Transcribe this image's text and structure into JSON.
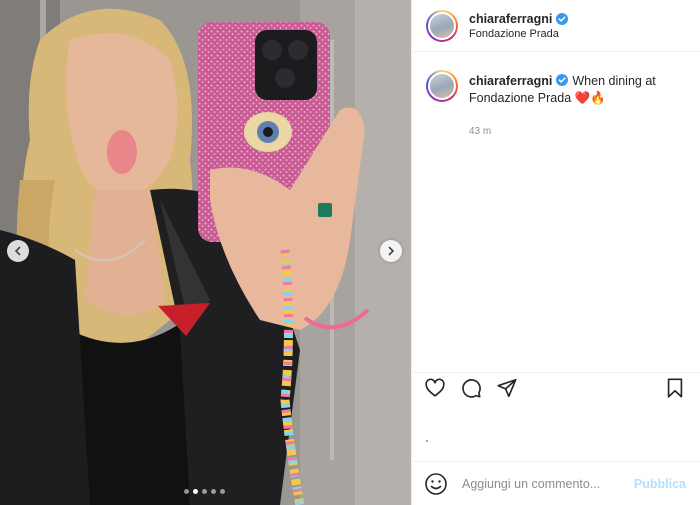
{
  "post": {
    "username": "chiaraferragni",
    "verified": true,
    "location": "Fondazione Prada",
    "caption_text": "When dining at Fondazione Prada",
    "caption_emoji": "❤️🔥",
    "time_ago": "43 m"
  },
  "carousel": {
    "slide_count": 5,
    "active_index": 1
  },
  "actions": {
    "like_icon": "heart-icon",
    "comment_icon": "comment-icon",
    "share_icon": "share-icon",
    "save_icon": "bookmark-icon"
  },
  "comment_box": {
    "placeholder": "Aggiungi un commento...",
    "publish_label": "Pubblica"
  },
  "colors": {
    "verified": "#3897f0",
    "publish_disabled": "#b2dffc",
    "muted_text": "#8e8e8e",
    "border": "#efefef"
  }
}
